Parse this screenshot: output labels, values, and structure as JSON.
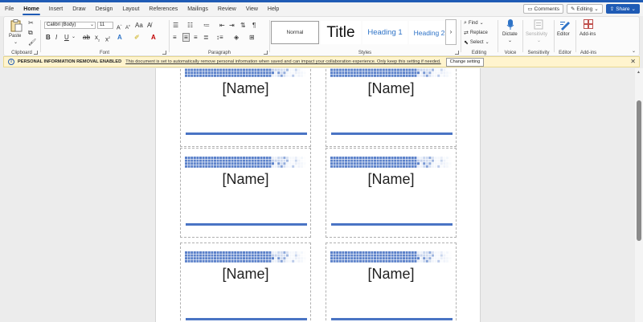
{
  "menu": {
    "tabs": [
      "File",
      "Home",
      "Insert",
      "Draw",
      "Design",
      "Layout",
      "References",
      "Mailings",
      "Review",
      "View",
      "Help"
    ],
    "active": "Home",
    "comments_label": "Comments",
    "editing_label": "Editing",
    "share_label": "Share"
  },
  "ribbon": {
    "clipboard": {
      "paste_label": "Paste",
      "group_label": "Clipboard"
    },
    "font": {
      "font_name": "Calibri (Body)",
      "font_size": "11",
      "group_label": "Font"
    },
    "paragraph": {
      "group_label": "Paragraph"
    },
    "styles": {
      "normal": "Normal",
      "title": "Title",
      "heading1": "Heading 1",
      "heading2": "Heading 2",
      "group_label": "Styles"
    },
    "editing": {
      "find": "Find",
      "replace": "Replace",
      "select": "Select",
      "group_label": "Editing"
    },
    "voice": {
      "dictate": "Dictate",
      "group_label": "Voice"
    },
    "sensitivity": {
      "label": "Sensitivity",
      "group_label": "Sensitivity"
    },
    "editor": {
      "label": "Editor",
      "group_label": "Editor"
    },
    "addins": {
      "label": "Add-ins",
      "group_label": "Add-ins"
    }
  },
  "infobar": {
    "title": "PERSONAL INFORMATION REMOVAL ENABLED",
    "message": "This document is set to automatically remove personal information when saved and can impact your collaboration experience. Only keep this setting if needed.",
    "button": "Change setting"
  },
  "document": {
    "cards": [
      {
        "name": "[Name]"
      },
      {
        "name": "[Name]"
      },
      {
        "name": "[Name]"
      },
      {
        "name": "[Name]"
      },
      {
        "name": "[Name]"
      },
      {
        "name": "[Name]"
      }
    ]
  },
  "colors": {
    "accent": "#1f5bb5",
    "card_bar": "#4a74c4",
    "heading": "#2e73c7",
    "infobar_bg": "#fff4ce"
  },
  "icons": {
    "info": "info-icon",
    "close": "close-icon",
    "paste": "clipboard-icon",
    "dictate": "microphone-icon",
    "editor": "pen-icon",
    "addins": "grid-icon"
  }
}
